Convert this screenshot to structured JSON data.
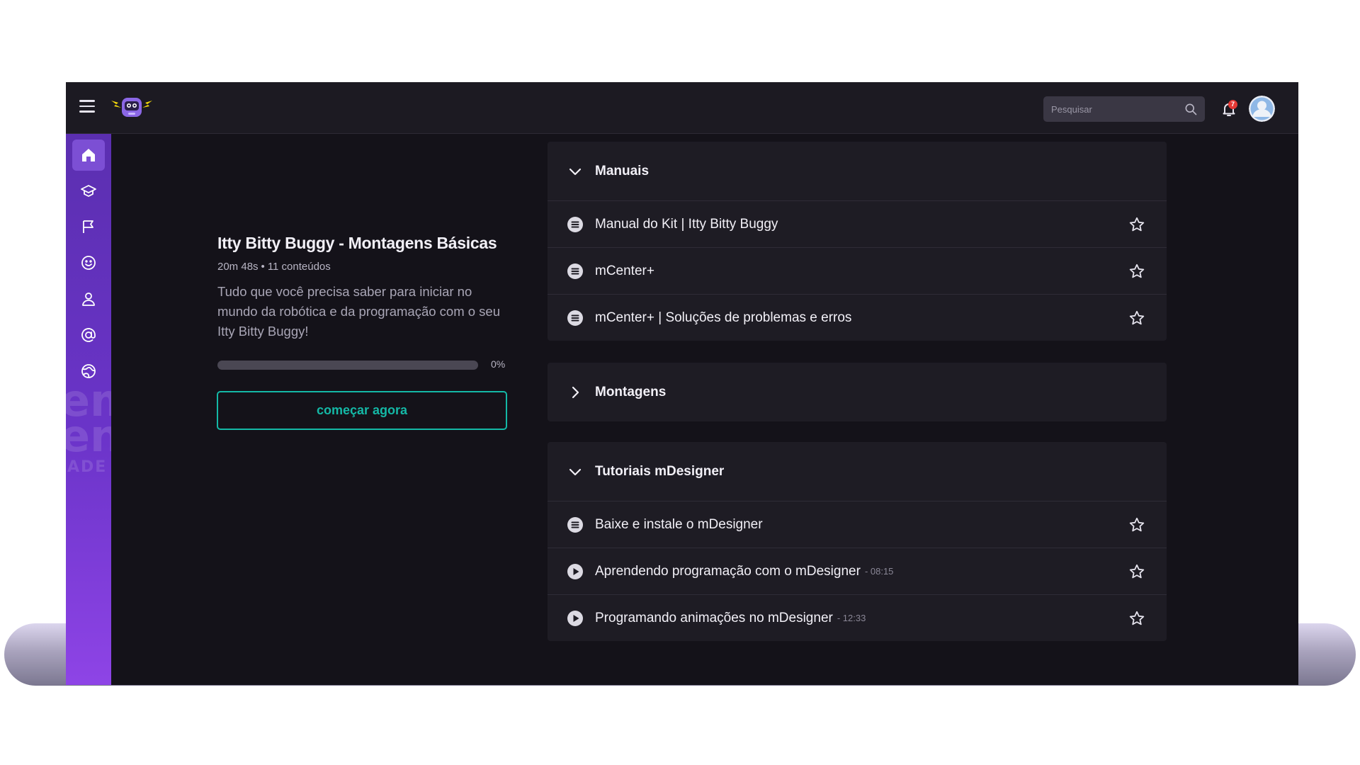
{
  "header": {
    "search_placeholder": "Pesquisar",
    "notification_count": "7"
  },
  "sidebar": {
    "items": [
      {
        "name": "home",
        "icon": "home-icon",
        "active": true
      },
      {
        "name": "courses",
        "icon": "graduation-cap-icon"
      },
      {
        "name": "missions",
        "icon": "flag-icon"
      },
      {
        "name": "emotions",
        "icon": "smile-icon"
      },
      {
        "name": "profile",
        "icon": "user-icon"
      },
      {
        "name": "community",
        "icon": "at-sign-icon"
      },
      {
        "name": "explore",
        "icon": "globe-icon"
      }
    ],
    "watermark": [
      "em",
      "en",
      "ADE"
    ]
  },
  "course": {
    "title": "Itty Bitty Buggy - Montagens Básicas",
    "duration": "20m 48s",
    "separator": "•",
    "contents": "11 conteúdos",
    "description": "Tudo que você precisa saber para iniciar no mundo da robótica e da programação com o seu Itty Bitty Buggy!",
    "progress": 0,
    "progress_label": "0%",
    "start_label": "começar agora"
  },
  "sections": [
    {
      "title": "Manuais",
      "expanded": true,
      "items": [
        {
          "type": "document",
          "title": "Manual do Kit | Itty Bitty Buggy"
        },
        {
          "type": "document",
          "title": "mCenter+"
        },
        {
          "type": "document",
          "title": "mCenter+ | Soluções de problemas e erros"
        }
      ]
    },
    {
      "title": "Montagens",
      "expanded": false,
      "items": []
    },
    {
      "title": "Tutoriais mDesigner",
      "expanded": true,
      "items": [
        {
          "type": "document",
          "title": "Baixe e instale o mDesigner"
        },
        {
          "type": "video",
          "title": "Aprendendo programação com o mDesigner",
          "duration": "- 08:15"
        },
        {
          "type": "video",
          "title": "Programando animações no mDesigner",
          "duration": "- 12:33"
        }
      ]
    }
  ],
  "colors": {
    "accent": "#14b8a6",
    "sidebar_top": "#5b2fb0",
    "sidebar_bottom": "#8e44e6",
    "background": "#141219",
    "card": "#1e1c24"
  }
}
